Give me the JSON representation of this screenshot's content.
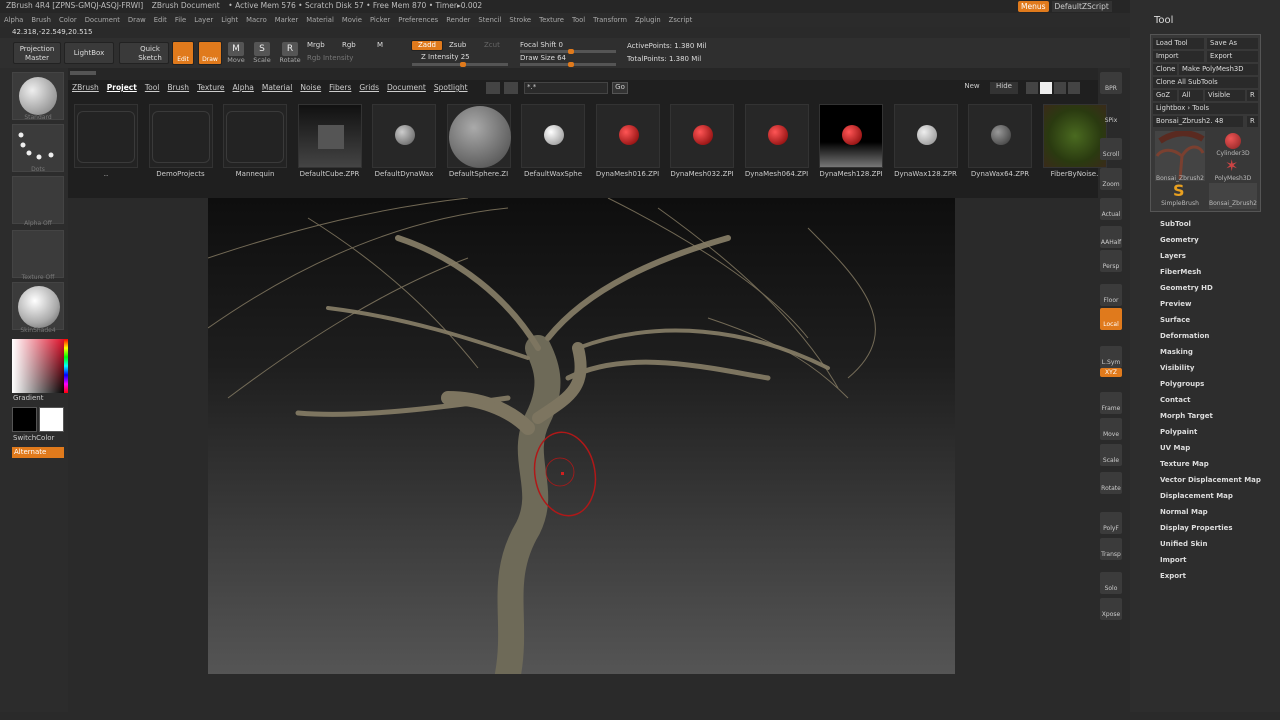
{
  "titlebar": {
    "app": "ZBrush 4R4 [ZPNS-GMQJ-ASQJ-FRWI]",
    "doc": "ZBrush Document",
    "mem": "• Active Mem 576 • Scratch Disk 57 • Free Mem 870 • Timer▸0.002"
  },
  "menus": [
    "Alpha",
    "Brush",
    "Color",
    "Document",
    "Draw",
    "Edit",
    "File",
    "Layer",
    "Light",
    "Macro",
    "Marker",
    "Material",
    "Movie",
    "Picker",
    "Preferences",
    "Render",
    "Stencil",
    "Stroke",
    "Texture",
    "Tool",
    "Transform",
    "Zplugin",
    "Zscript"
  ],
  "topright": {
    "menus": "Menus",
    "zscript": "DefaultZScript"
  },
  "coords": "42.318,-22.549,20.515",
  "shelf": {
    "projection_master": "Projection Master",
    "lightbox": "LightBox",
    "quick_sketch": "Quick Sketch",
    "edit": "Edit",
    "draw": "Draw",
    "move": "Move",
    "scale": "Scale",
    "rotate": "Rotate",
    "mrgb": "Mrgb",
    "rgb": "Rgb",
    "m": "M",
    "rgb_intensity": "Rgb Intensity",
    "zadd": "Zadd",
    "zsub": "Zsub",
    "zcut": "Zcut",
    "z_intensity": "Z Intensity 25",
    "focal_shift": "Focal Shift 0",
    "draw_size": "Draw Size 64",
    "active_points": "ActivePoints: 1.380 Mil",
    "total_points": "TotalPoints: 1.380 Mil"
  },
  "leftpanel": {
    "brush": "Standard",
    "stroke": "Dots",
    "alpha": "Alpha Off",
    "texture": "Texture Off",
    "material": "SkinShade4",
    "gradient": "Gradient",
    "switchcolor": "SwitchColor",
    "alternate": "Alternate"
  },
  "lightbox": {
    "tabs": [
      "ZBrush",
      "Project",
      "Tool",
      "Brush",
      "Texture",
      "Alpha",
      "Material",
      "Noise",
      "Fibers",
      "Grids",
      "Document",
      "Spotlight"
    ],
    "active_tab": "Project",
    "search_value": "*.*",
    "go": "Go",
    "new": "New",
    "hide": "Hide",
    "items": [
      {
        "label": ".."
      },
      {
        "label": "DemoProjects"
      },
      {
        "label": "Mannequin"
      },
      {
        "label": "DefaultCube.ZPR"
      },
      {
        "label": "DefaultDynaWax"
      },
      {
        "label": "DefaultSphere.ZI"
      },
      {
        "label": "DefaultWaxSphe"
      },
      {
        "label": "DynaMesh016.ZPI"
      },
      {
        "label": "DynaMesh032.ZPI"
      },
      {
        "label": "DynaMesh064.ZPI"
      },
      {
        "label": "DynaMesh128.ZPI"
      },
      {
        "label": "DynaWax128.ZPR"
      },
      {
        "label": "DynaWax64.ZPR"
      },
      {
        "label": "FiberByNoise."
      }
    ]
  },
  "rightbar": [
    "BPR",
    "SPix",
    "Scroll",
    "Zoom",
    "Actual",
    "AAHalf",
    "Persp",
    "Floor",
    "Local",
    "L.Sym",
    "XYZ",
    "Frame",
    "Move",
    "Scale",
    "Rotate",
    "PolyF",
    "Transp",
    "Solo",
    "Xpose"
  ],
  "toolpanel": {
    "title": "Tool",
    "load": "Load Tool",
    "save": "Save As",
    "import": "Import",
    "export": "Export",
    "clone": "Clone",
    "make_polymesh": "Make PolyMesh3D",
    "clone_all": "Clone All SubTools",
    "goz": "GoZ",
    "all": "All",
    "visible": "Visible",
    "r": "R",
    "lightbox_tools": "Lightbox › Tools",
    "current": "Bonsai_Zbrush2. 48",
    "subs": [
      "Bonsai_Zbrush2",
      "Cylinder3D",
      "PolyMesh3D",
      "SimpleBrush",
      "Bonsai_Zbrush2"
    ],
    "menu": [
      "SubTool",
      "Geometry",
      "Layers",
      "FiberMesh",
      "Geometry HD",
      "Preview",
      "Surface",
      "Deformation",
      "Masking",
      "Visibility",
      "Polygroups",
      "Contact",
      "Morph Target",
      "Polypaint",
      "UV Map",
      "Texture Map",
      "Vector Displacement Map",
      "Displacement Map",
      "Normal Map",
      "Display Properties",
      "Unified Skin",
      "Import",
      "Export"
    ]
  }
}
